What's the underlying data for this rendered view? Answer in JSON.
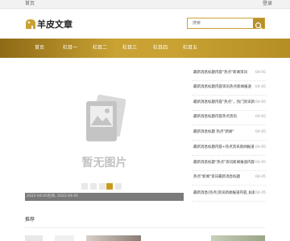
{
  "topbar": {
    "left": "首页",
    "right": "登录"
  },
  "logo": {
    "text": "羊皮文章"
  },
  "search": {
    "placeholder": "搜索"
  },
  "nav": {
    "items": [
      "首页",
      "栏目一",
      "栏目二",
      "栏目三",
      "栏目四",
      "栏目五"
    ]
  },
  "banner": {
    "no_image": "暂无图片",
    "caption": "2022-04-05栏目, 2022-04-05"
  },
  "news": [
    {
      "title": "最新消息标题内容\"热点\"新闻资讯",
      "date": "04-05"
    },
    {
      "title": "最新消息标题内容资讯热点新闻报道",
      "date": "04-05"
    },
    {
      "title": "最新消息标题内容\"热点\"，热门资讯新闻报道内容",
      "date": "04-05"
    },
    {
      "title": "最新消息标题内容热点资讯",
      "date": "04-05"
    },
    {
      "title": "最新消息标题 热点\"新闻\"",
      "date": "04-05"
    },
    {
      "title": "最新消息标题内容+热点资讯新闻报道",
      "date": "04-05"
    },
    {
      "title": "最新消息标题\"热点\"资讯新闻报道内容标题",
      "date": "04-05"
    },
    {
      "title": "热点\"新闻\"资讯最新消息标题",
      "date": "04-05"
    },
    {
      "title": "最新消息(热点)资讯新闻报道内容_标题+新闻报道",
      "date": "04-05"
    }
  ],
  "section": {
    "title": "推荐"
  },
  "colors": {
    "gold": "#c9a233",
    "dark_gold": "#8f6a16"
  }
}
